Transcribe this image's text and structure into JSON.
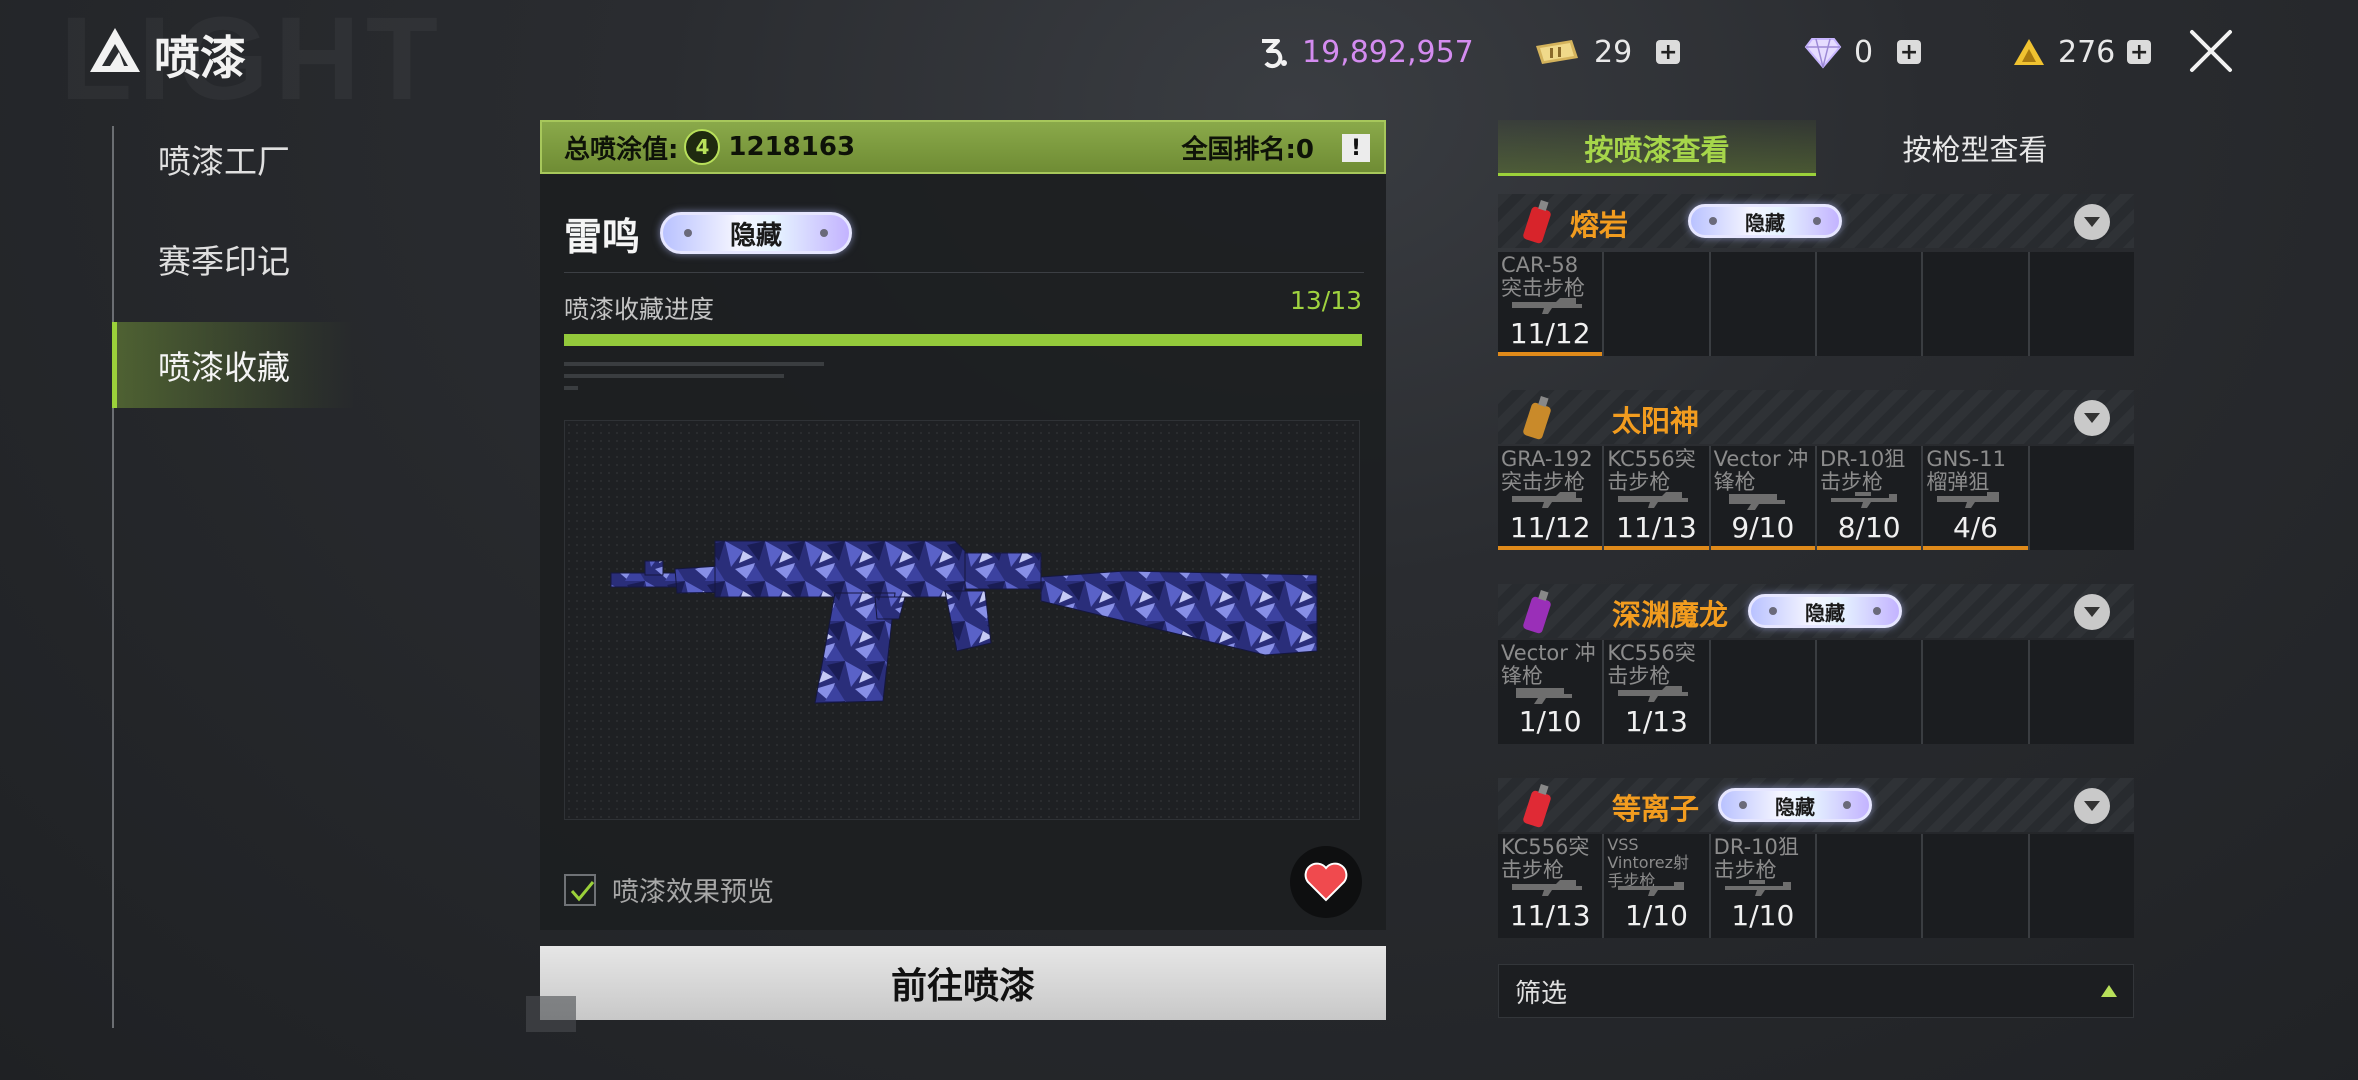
{
  "header": {
    "watermark": "LIGHT",
    "title": "喷漆",
    "currencies": [
      {
        "icon": "mark-currency-icon",
        "value": "19,892,957",
        "color": "#d48cf0",
        "plus": false
      },
      {
        "icon": "ticket-currency-icon",
        "value": "29",
        "color": "#f0f0f0",
        "plus": true
      },
      {
        "icon": "diamond-currency-icon",
        "value": "0",
        "color": "#f0f0f0",
        "plus": true
      },
      {
        "icon": "triangle-gold-currency-icon",
        "value": "276",
        "color": "#f0f0f0",
        "plus": true
      }
    ]
  },
  "nav": {
    "items": [
      {
        "label": "喷漆工厂",
        "active": false
      },
      {
        "label": "赛季印记",
        "active": false
      },
      {
        "label": "喷漆收藏",
        "active": true
      }
    ]
  },
  "summary": {
    "total_label": "总喷涂值:",
    "total_value": "1218163",
    "rank_label": "全国排名:0",
    "warn_symbol": "!"
  },
  "skin": {
    "name": "雷鸣",
    "tag": "隐藏",
    "progress_label": "喷漆收藏进度",
    "progress_text": "13/13",
    "progress_fraction": 1.0,
    "preview_label": "喷漆效果预览",
    "preview_checked": true,
    "goto_label": "前往喷漆"
  },
  "tabs": {
    "by_spray": "按喷漆查看",
    "by_weapon": "按枪型查看"
  },
  "groups": [
    {
      "name": "熔岩",
      "tag": "隐藏",
      "can_color": "#d8242b",
      "weapons": [
        {
          "name": "CAR-58 突击步枪",
          "count": "11/12"
        }
      ]
    },
    {
      "name": "太阳神",
      "tag": "",
      "can_color": "#c98a2a",
      "weapons": [
        {
          "name": "GRA-192 突击步枪",
          "count": "11/12"
        },
        {
          "name": "KC556突 击步枪",
          "count": "11/13"
        },
        {
          "name": "Vector 冲锋枪",
          "count": "9/10"
        },
        {
          "name": "DR-10狙 击步枪",
          "count": "8/10"
        },
        {
          "name": "GNS-11 榴弹狙",
          "count": "4/6"
        }
      ]
    },
    {
      "name": "深渊魔龙",
      "tag": "隐藏",
      "can_color": "#9a2fb8",
      "weapons": [
        {
          "name": "Vector 冲锋枪",
          "count": "1/10"
        },
        {
          "name": "KC556突 击步枪",
          "count": "1/13"
        }
      ]
    },
    {
      "name": "等离子",
      "tag": "隐藏",
      "can_color": "#e02a35",
      "weapons": [
        {
          "name": "KC556突 击步枪",
          "count": "11/13"
        },
        {
          "name": "VSS Vintorez射 手步枪",
          "count": "1/10"
        },
        {
          "name": "DR-10狙 击步枪",
          "count": "1/10"
        }
      ]
    }
  ],
  "filter": {
    "label": "筛选"
  },
  "colors": {
    "accent_green": "#9bd13a",
    "orange_name": "#f29c1f",
    "count_bar": "#e08a1a"
  }
}
